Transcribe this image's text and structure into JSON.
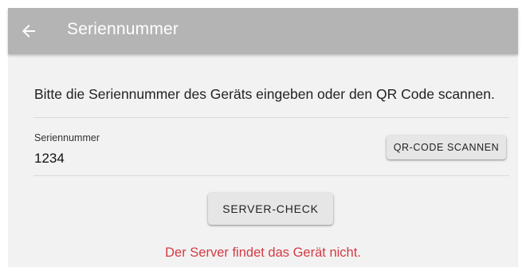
{
  "appbar": {
    "back_icon": "arrow-left-icon",
    "title": "Seriennummer",
    "background_color": "#b4b4b4"
  },
  "main": {
    "instruction": "Bitte die Seriennummer des Geräts eingeben oder den QR Code scannen.",
    "serial_field": {
      "label": "Seriennummer",
      "value": "1234"
    },
    "qr_button_label": "QR-CODE SCANNEN",
    "server_check_button_label": "SERVER-CHECK",
    "error_message": "Der Server findet das Gerät nicht.",
    "error_color": "#d43b43"
  }
}
